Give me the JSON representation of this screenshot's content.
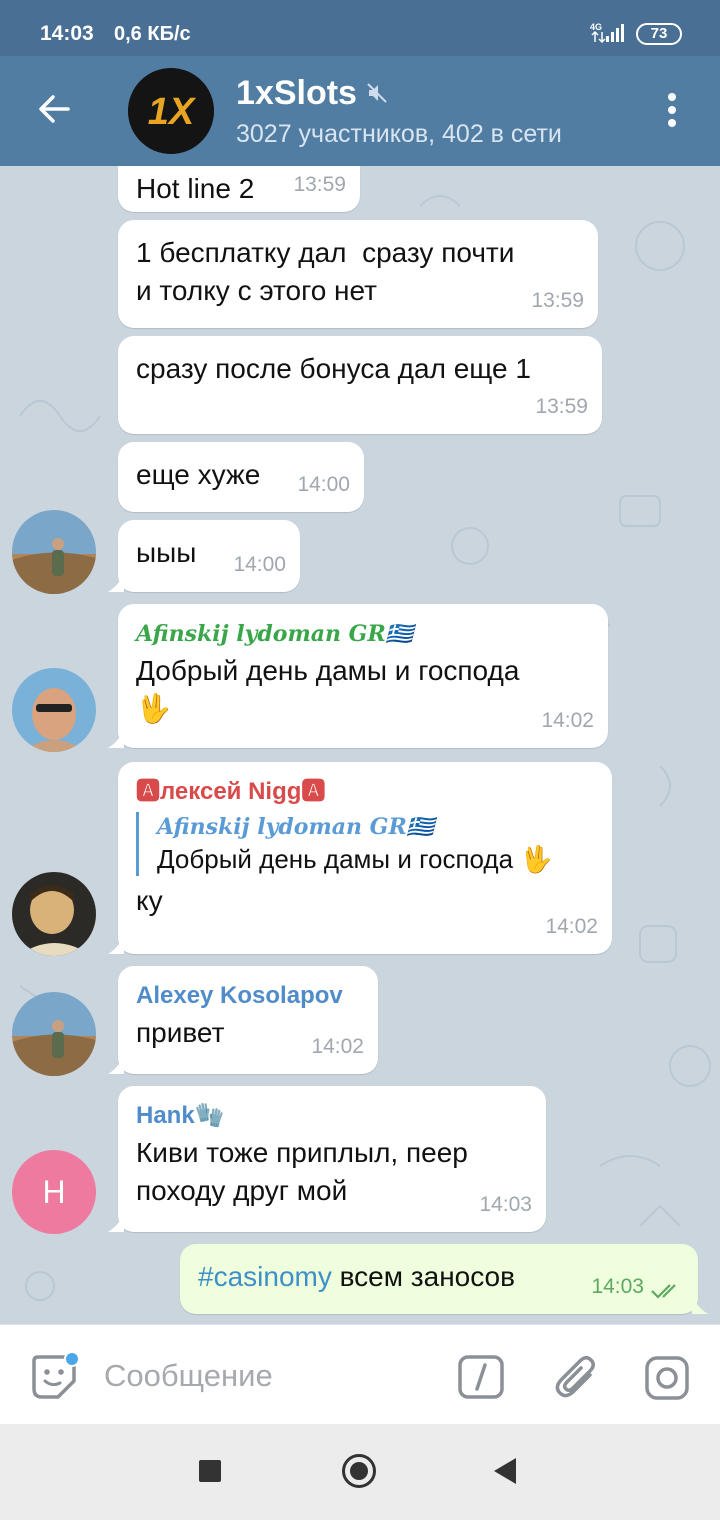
{
  "status_bar": {
    "time": "14:03",
    "speed": "0,6 КБ/с",
    "network": "4G",
    "battery": "73"
  },
  "header": {
    "title": "1xSlots",
    "subtitle": "3027 участников, 402 в сети",
    "avatar_logo": "1X"
  },
  "messages": [
    {
      "text": "Hot line 2",
      "time": "13:59"
    },
    {
      "text": "1 бесплатку дал  сразу почти\nи толку с этого нет",
      "time": "13:59"
    },
    {
      "text": "сразу после бонуса дал еще 1",
      "time": "13:59"
    },
    {
      "text": "еще хуже",
      "time": "14:00"
    },
    {
      "text": "ыыы",
      "time": "14:00"
    },
    {
      "sender": "Afinskij lydoman GR🇬🇷",
      "text": "Добрый день дамы и господа\n🖖",
      "time": "14:02"
    },
    {
      "sender": "🅰лексей Nigg🅰",
      "reply_name": "Afinskij lydoman GR🇬🇷",
      "reply_text": "Добрый день дамы и господа 🖖",
      "text": "ку",
      "time": "14:02"
    },
    {
      "sender": "Alexey Kosolapov",
      "text": "привет",
      "time": "14:02"
    },
    {
      "sender": "Hank🧤",
      "text": "Киви тоже приплыл, пеер\nпоходу друг мой",
      "time": "14:03",
      "avatar_letter": "H"
    },
    {
      "hashtag": "#casinomy",
      "text": " всем заносов",
      "time": "14:03"
    }
  ],
  "input": {
    "placeholder": "Сообщение"
  },
  "colors": {
    "header_bg": "#527da3",
    "statusbar_bg": "#4a6f94",
    "chat_bg": "#cbd5de",
    "outgoing_bubble": "#effedd",
    "sender_green": "#3aa64a",
    "sender_red": "#d94a4a",
    "sender_blue": "#4f8cc9",
    "hashtag": "#3f8fc8"
  }
}
